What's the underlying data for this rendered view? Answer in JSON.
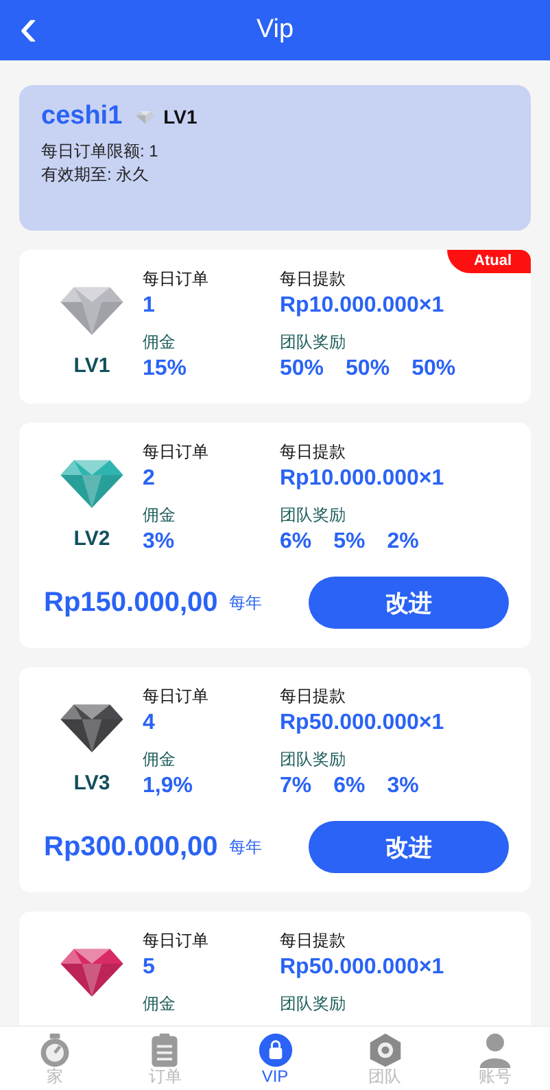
{
  "header": {
    "title": "Vip",
    "back": "‹"
  },
  "user": {
    "name": "ceshi1",
    "level": "LV1",
    "color": "#c8ccd4",
    "lines": [
      "每日订单限额: 1",
      "有效期至: 永久"
    ]
  },
  "cards": [
    {
      "level": "LV1",
      "color": "#b8b9c0",
      "badge": "Atual",
      "orders_label": "每日订单",
      "orders": "1",
      "withdraw_label": "每日提款",
      "withdraw": "Rp10.000.000×1",
      "commission_label": "佣金",
      "commission": "15%",
      "team_label": "团队奖励",
      "team": [
        "50%",
        "50%",
        "50%"
      ]
    },
    {
      "level": "LV2",
      "color": "#2fb5b0",
      "orders_label": "每日订单",
      "orders": "2",
      "withdraw_label": "每日提款",
      "withdraw": "Rp10.000.000×1",
      "commission_label": "佣金",
      "commission": "3%",
      "team_label": "团队奖励",
      "team": [
        "6%",
        "5%",
        "2%"
      ],
      "price": "Rp150.000,00",
      "period": "每年",
      "button": "改进"
    },
    {
      "level": "LV3",
      "color": "#4a4a4e",
      "orders_label": "每日订单",
      "orders": "4",
      "withdraw_label": "每日提款",
      "withdraw": "Rp50.000.000×1",
      "commission_label": "佣金",
      "commission": "1,9%",
      "team_label": "团队奖励",
      "team": [
        "7%",
        "6%",
        "3%"
      ],
      "price": "Rp300.000,00",
      "period": "每年",
      "button": "改进"
    },
    {
      "color": "#d82a64",
      "orders_label": "每日订单",
      "orders": "5",
      "withdraw_label": "每日提款",
      "withdraw": "Rp50.000.000×1",
      "commission_label": "佣金",
      "team_label": "团队奖励"
    }
  ],
  "tabbar": [
    {
      "label": "家",
      "kind": "home",
      "selected": false
    },
    {
      "label": "订单",
      "kind": "orders",
      "selected": false
    },
    {
      "label": "VIP",
      "kind": "vip",
      "selected": true
    },
    {
      "label": "团队",
      "kind": "team",
      "selected": false
    },
    {
      "label": "账号",
      "kind": "account",
      "selected": false
    }
  ]
}
